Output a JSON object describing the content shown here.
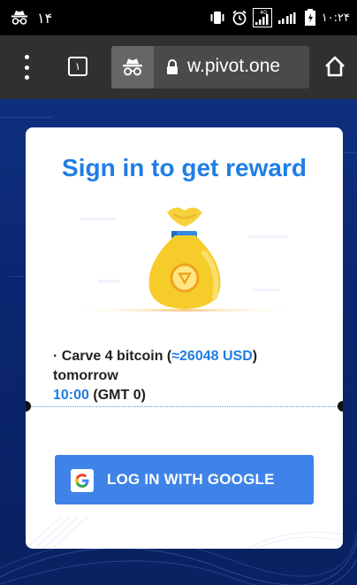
{
  "status_bar": {
    "left_text": "۱۴",
    "time": "۱۰:۲۴",
    "icons": [
      "incognito-icon",
      "vibrate-icon",
      "alarm-icon",
      "signal-4g-icon",
      "signal-icon",
      "battery-icon"
    ]
  },
  "browser": {
    "tab_count": "۱",
    "url": "w.pivot.one",
    "icons": [
      "menu-icon",
      "tabs-icon",
      "incognito-icon",
      "lock-icon",
      "home-icon"
    ]
  },
  "card": {
    "title": "Sign in to get reward",
    "line1_prefix": "· Carve 4 bitcoin (",
    "line1_value": "≈26048 USD",
    "line1_suffix": ")",
    "line2": "tomorrow",
    "time_value": "10:00",
    "time_suffix": " (GMT 0)",
    "button_label": "LOG IN WITH GOOGLE"
  },
  "colors": {
    "accent": "#1f7ee4",
    "button": "#3f83e8",
    "bag": "#f6cc2a",
    "page_bg": "#0d2a78"
  }
}
